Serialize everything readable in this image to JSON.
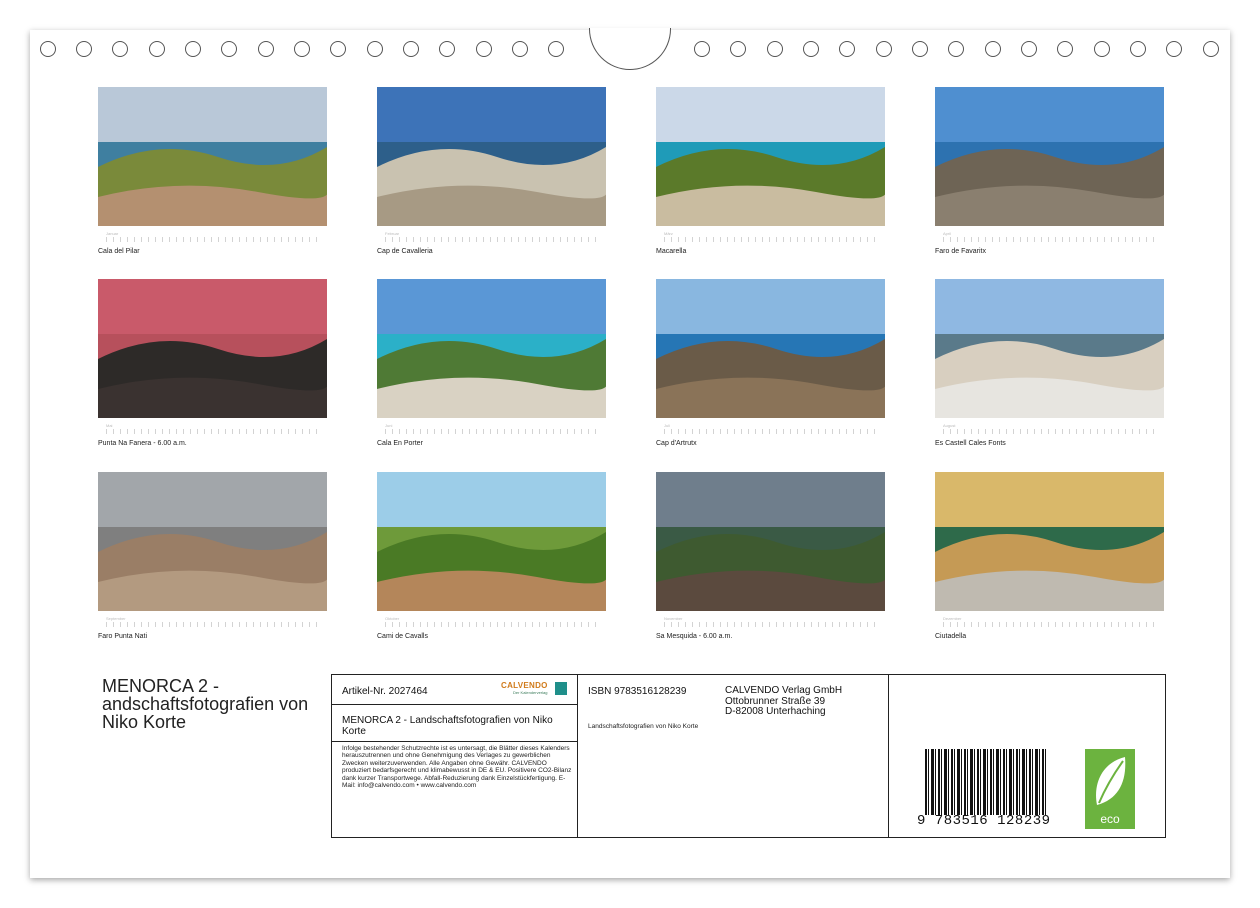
{
  "months": [
    {
      "name": "Januar",
      "caption": "Cala del Pilar",
      "sky": "#b9c8d8",
      "sea": "#3f7fa0",
      "land": "#7a8a3a",
      "rock": "#b49070"
    },
    {
      "name": "Februar",
      "caption": "Cap de Cavalleria",
      "sky": "#3d73b8",
      "sea": "#2d5f8a",
      "land": "#c9c2b0",
      "rock": "#a79a84"
    },
    {
      "name": "März",
      "caption": "Macarella",
      "sky": "#cbd8e8",
      "sea": "#1f9bb8",
      "land": "#5b7a2a",
      "rock": "#c9bca0"
    },
    {
      "name": "April",
      "caption": "Faro de Favaritx",
      "sky": "#4f8fd0",
      "sea": "#2d72b0",
      "land": "#6e6455",
      "rock": "#8a7f6f"
    },
    {
      "name": "Mai",
      "caption": "Punta Na Fanera - 6.00 a.m.",
      "sky": "#c95a6a",
      "sea": "#b7505c",
      "land": "#2d2a28",
      "rock": "#3a3230"
    },
    {
      "name": "Juni",
      "caption": "Cala En Porter",
      "sky": "#5a97d6",
      "sea": "#2bb0c8",
      "land": "#4f7a35",
      "rock": "#d9d2c3"
    },
    {
      "name": "Juli",
      "caption": "Cap d'Artrutx",
      "sky": "#89b7e0",
      "sea": "#2676b5",
      "land": "#6a5b48",
      "rock": "#8a7358"
    },
    {
      "name": "August",
      "caption": "Es Castell Cales Fonts",
      "sky": "#8fb8e2",
      "sea": "#5a7a8a",
      "land": "#d8cfc0",
      "rock": "#e7e5e0"
    },
    {
      "name": "September",
      "caption": "Faro Punta Nati",
      "sky": "#a2a6aa",
      "sea": "#7f7f7f",
      "land": "#9a7e66",
      "rock": "#b39a80"
    },
    {
      "name": "Oktober",
      "caption": "Cami de Cavalls",
      "sky": "#9ccde8",
      "sea": "#6e9a3a",
      "land": "#4a7a25",
      "rock": "#b4865a"
    },
    {
      "name": "November",
      "caption": "Sa Mesquida - 6.00 a.m.",
      "sky": "#6f7e8c",
      "sea": "#3a5a45",
      "land": "#3e5a30",
      "rock": "#5b4a3e"
    },
    {
      "name": "Dezember",
      "caption": "Ciutadella",
      "sky": "#d9b86a",
      "sea": "#2e6a4a",
      "land": "#c59a55",
      "rock": "#bfbab0"
    }
  ],
  "book_title": "MENORCA 2 - andschaftsfotografien von Niko Korte",
  "info": {
    "artikel": "Artikel-Nr. 2027464",
    "logo_text": "CALVENDO",
    "logo_sub": "Der Kalenderverlag",
    "title": "MENORCA 2 - Landschaftsfotografien von Niko Korte",
    "legal": "Infolge bestehender Schutzrechte ist es untersagt, die Blätter dieses Kalenders herauszutrennen und ohne Genehmigung des Verlages zu gewerblichen Zwecken weiterzuverwenden. Alle Angaben ohne Gewähr. CALVENDO produziert bedarfsgerecht und klimabewusst in DE & EU. Positivere CO2-Bilanz dank kurzer Transportwege. Abfall-Reduzierung dank Einzelstückfertigung. E-Mail: info@calvendo.com • www.calvendo.com",
    "isbn": "ISBN 9783516128239",
    "publisher_1": "CALVENDO Verlag GmbH",
    "publisher_2": "Ottobrunner Straße 39",
    "publisher_3": "D-82008 Unterhaching",
    "subtitle": "Landschaftsfotografien von Niko Korte",
    "barcode_number": "9 783516 128239",
    "eco_label": "eco"
  }
}
